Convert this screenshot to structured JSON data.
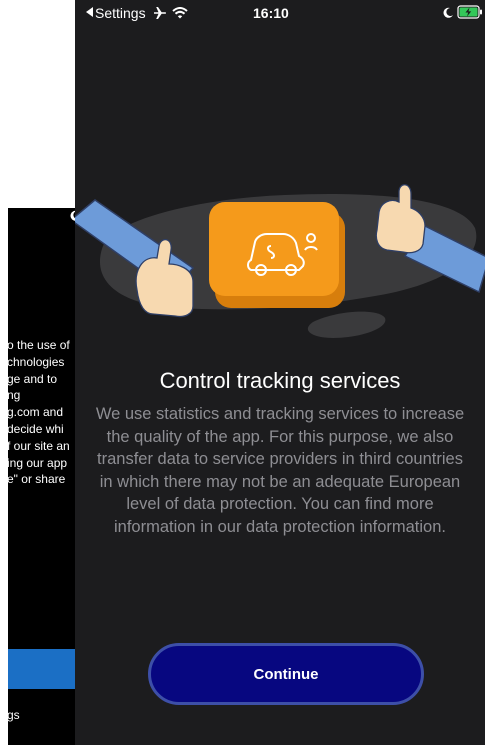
{
  "background_screen": {
    "text_lines": [
      "o the use of",
      "chnologies",
      "ge and to",
      "ng",
      "g.com and",
      "decide whi",
      "f our site an",
      "ing our app",
      "e\" or share"
    ],
    "bottom_label": "gs",
    "bar_color": "#1b6fc5"
  },
  "status_bar": {
    "back_label": "Settings",
    "time": "16:10"
  },
  "onboarding": {
    "title": "Control tracking services",
    "description": "We use statistics and tracking services to increase the quality of the app. For this purpose, we also transfer data to service providers in third countries in which there may not be an adequate European level of data protection. You can find more information in our data protection information.",
    "continue_label": "Continue"
  },
  "colors": {
    "screen_background": "#1c1c1e",
    "accent_orange": "#f59a1b",
    "button_fill": "#070780",
    "button_border": "#3d4fa8",
    "body_text": "#8e8e93"
  },
  "icons": [
    "back-arrow-icon",
    "airplane-icon",
    "wifi-icon",
    "moon-icon",
    "battery-charging-icon",
    "car-share-icon"
  ]
}
